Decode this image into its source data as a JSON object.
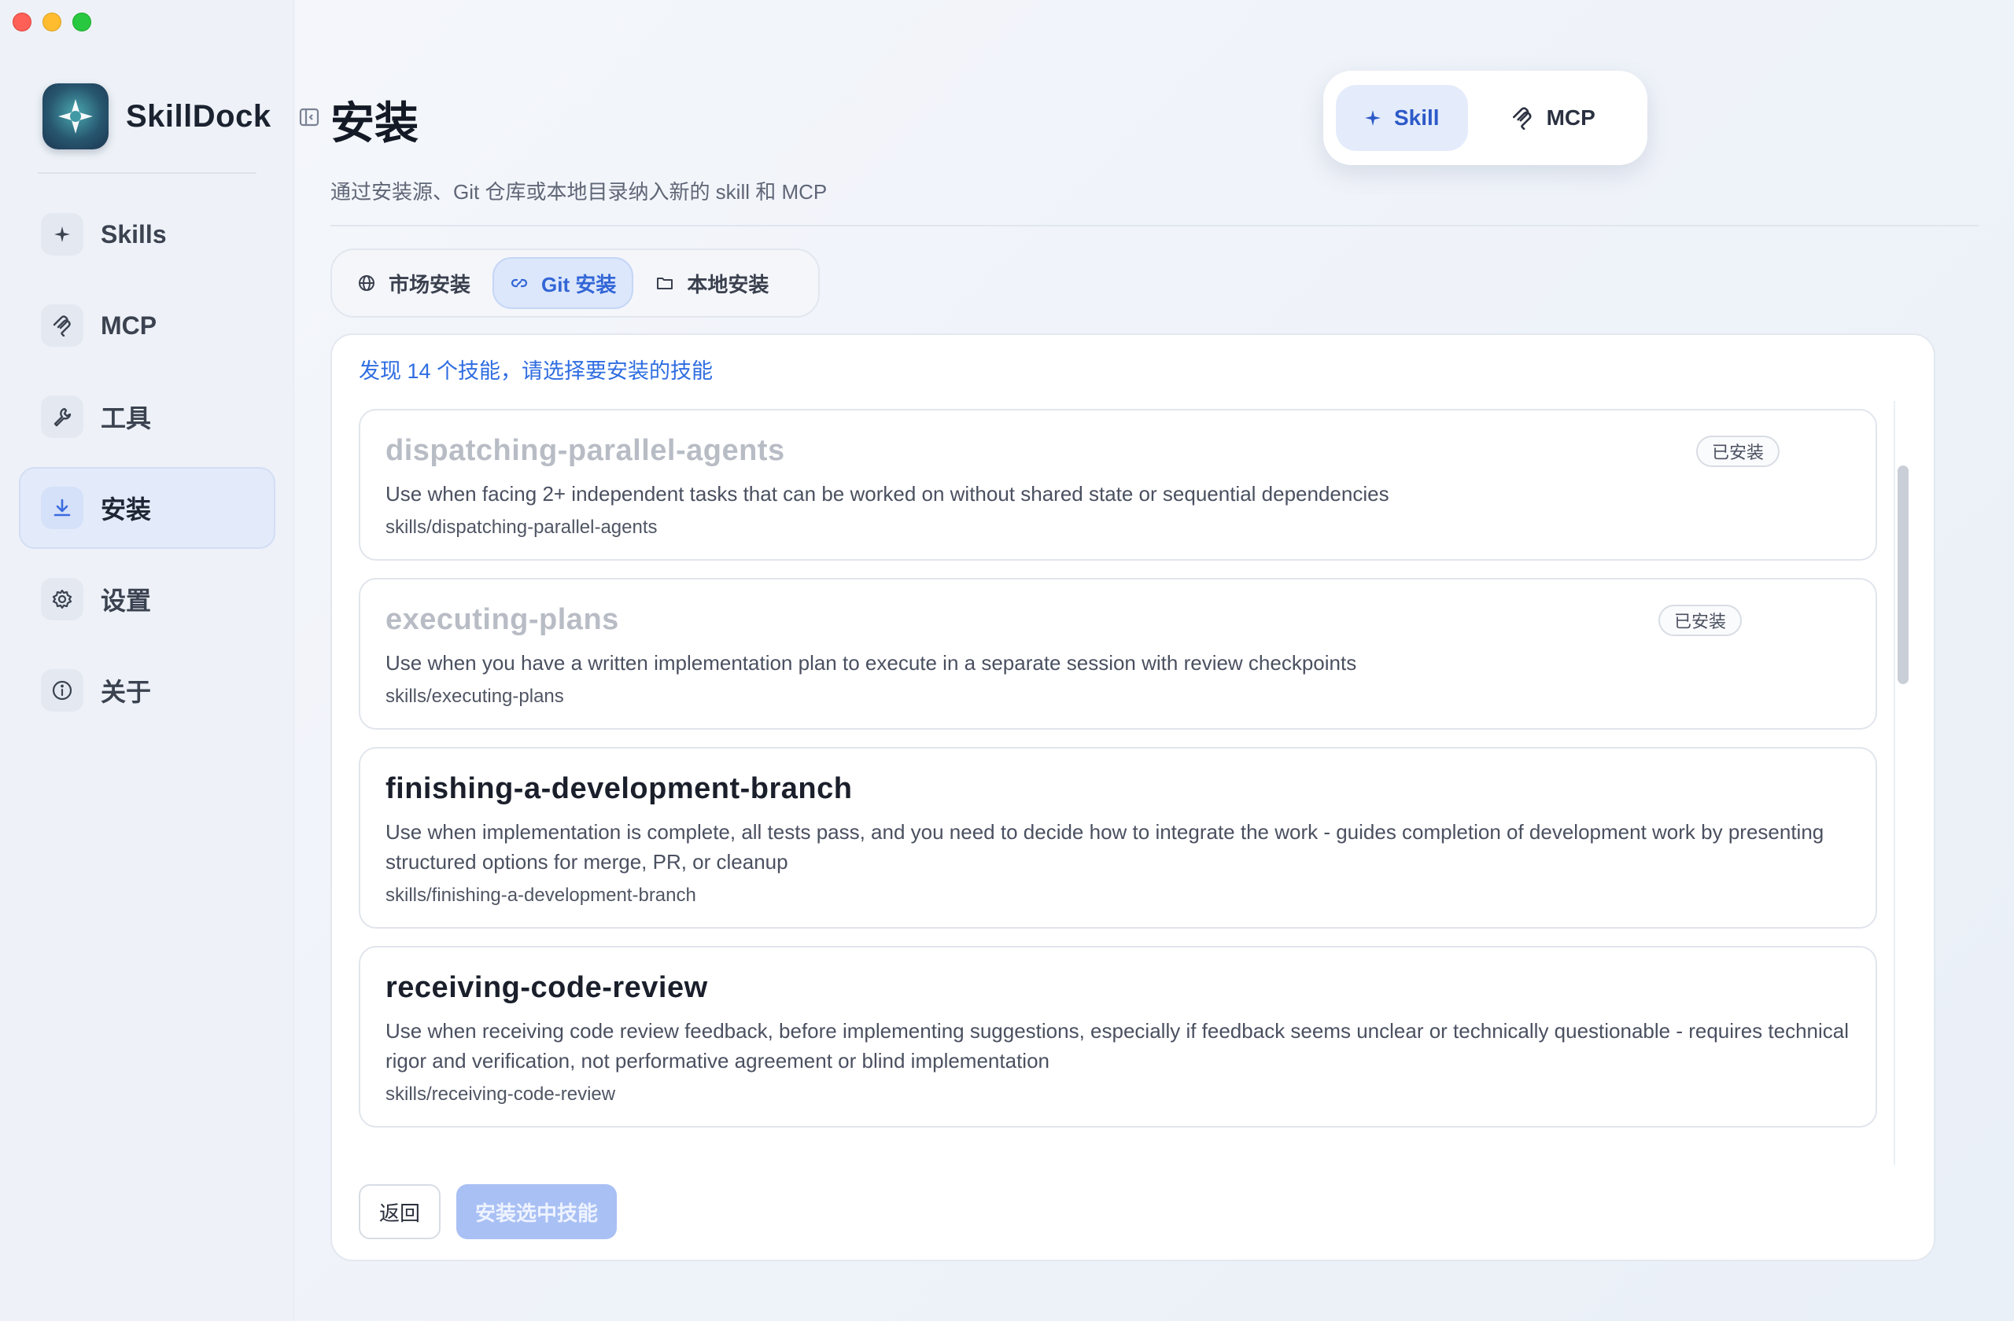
{
  "app": {
    "name": "SkillDock"
  },
  "sidebar": {
    "items": [
      {
        "label": "Skills",
        "icon": "sparkle-icon",
        "active": false
      },
      {
        "label": "MCP",
        "icon": "mcp-icon",
        "active": false
      },
      {
        "label": "工具",
        "icon": "wrench-icon",
        "active": false
      },
      {
        "label": "安装",
        "icon": "download-icon",
        "active": true
      },
      {
        "label": "设置",
        "icon": "gear-icon",
        "active": false
      },
      {
        "label": "关于",
        "icon": "info-icon",
        "active": false
      }
    ]
  },
  "header": {
    "title": "安装",
    "subtitle": "通过安装源、Git 仓库或本地目录纳入新的 skill 和 MCP"
  },
  "type_switch": {
    "skill_label": "Skill",
    "mcp_label": "MCP"
  },
  "method_tabs": {
    "market": "市场安装",
    "git": "Git 安装",
    "local": "本地安装"
  },
  "panel": {
    "found_text": "发现 14 个技能，请选择要安装的技能",
    "skills": [
      {
        "name": "dispatching-parallel-agents",
        "description": "Use when facing 2+ independent tasks that can be worked on without shared state or sequential dependencies",
        "path": "skills/dispatching-parallel-agents",
        "installed": true,
        "badge": "已安装"
      },
      {
        "name": "executing-plans",
        "description": "Use when you have a written implementation plan to execute in a separate session with review checkpoints",
        "path": "skills/executing-plans",
        "installed": true,
        "badge": "已安装"
      },
      {
        "name": "finishing-a-development-branch",
        "description": "Use when implementation is complete, all tests pass, and you need to decide how to integrate the work - guides completion of development work by presenting structured options for merge, PR, or cleanup",
        "path": "skills/finishing-a-development-branch",
        "installed": false,
        "badge": ""
      },
      {
        "name": "receiving-code-review",
        "description": "Use when receiving code review feedback, before implementing suggestions, especially if feedback seems unclear or technically questionable - requires technical rigor and verification, not performative agreement or blind implementation",
        "path": "skills/receiving-code-review",
        "installed": false,
        "badge": ""
      }
    ],
    "back_label": "返回",
    "install_label": "安装选中技能"
  },
  "colors": {
    "accent": "#2f6de1",
    "sidebar_bg": "#eef2f8",
    "install_btn_disabled": "#a9c0f4"
  }
}
